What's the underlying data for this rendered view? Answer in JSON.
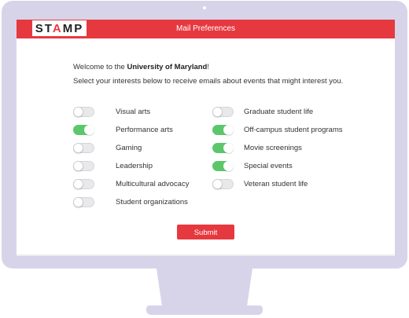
{
  "header": {
    "logo_text": "STAMP",
    "title": "Mail Preferences",
    "brand_color": "#e6393f"
  },
  "intro": {
    "welcome_prefix": "Welcome to the ",
    "university": "University of Maryland",
    "welcome_suffix": "!",
    "instructions": "Select your interests below to receive emails about events that might interest you."
  },
  "interests_left": [
    {
      "label": "Visual arts",
      "on": false
    },
    {
      "label": "Performance arts",
      "on": true
    },
    {
      "label": "Gaming",
      "on": false
    },
    {
      "label": "Leadership",
      "on": false
    },
    {
      "label": "Multicultural advocacy",
      "on": false
    },
    {
      "label": "Student organizations",
      "on": false
    }
  ],
  "interests_right": [
    {
      "label": "Graduate student life",
      "on": false
    },
    {
      "label": "Off-campus student programs",
      "on": true
    },
    {
      "label": "Movie screenings",
      "on": true
    },
    {
      "label": "Special events",
      "on": true
    },
    {
      "label": "Veteran student life",
      "on": false
    }
  ],
  "toggle_on_color": "#5cc76a",
  "submit_label": "Submit"
}
